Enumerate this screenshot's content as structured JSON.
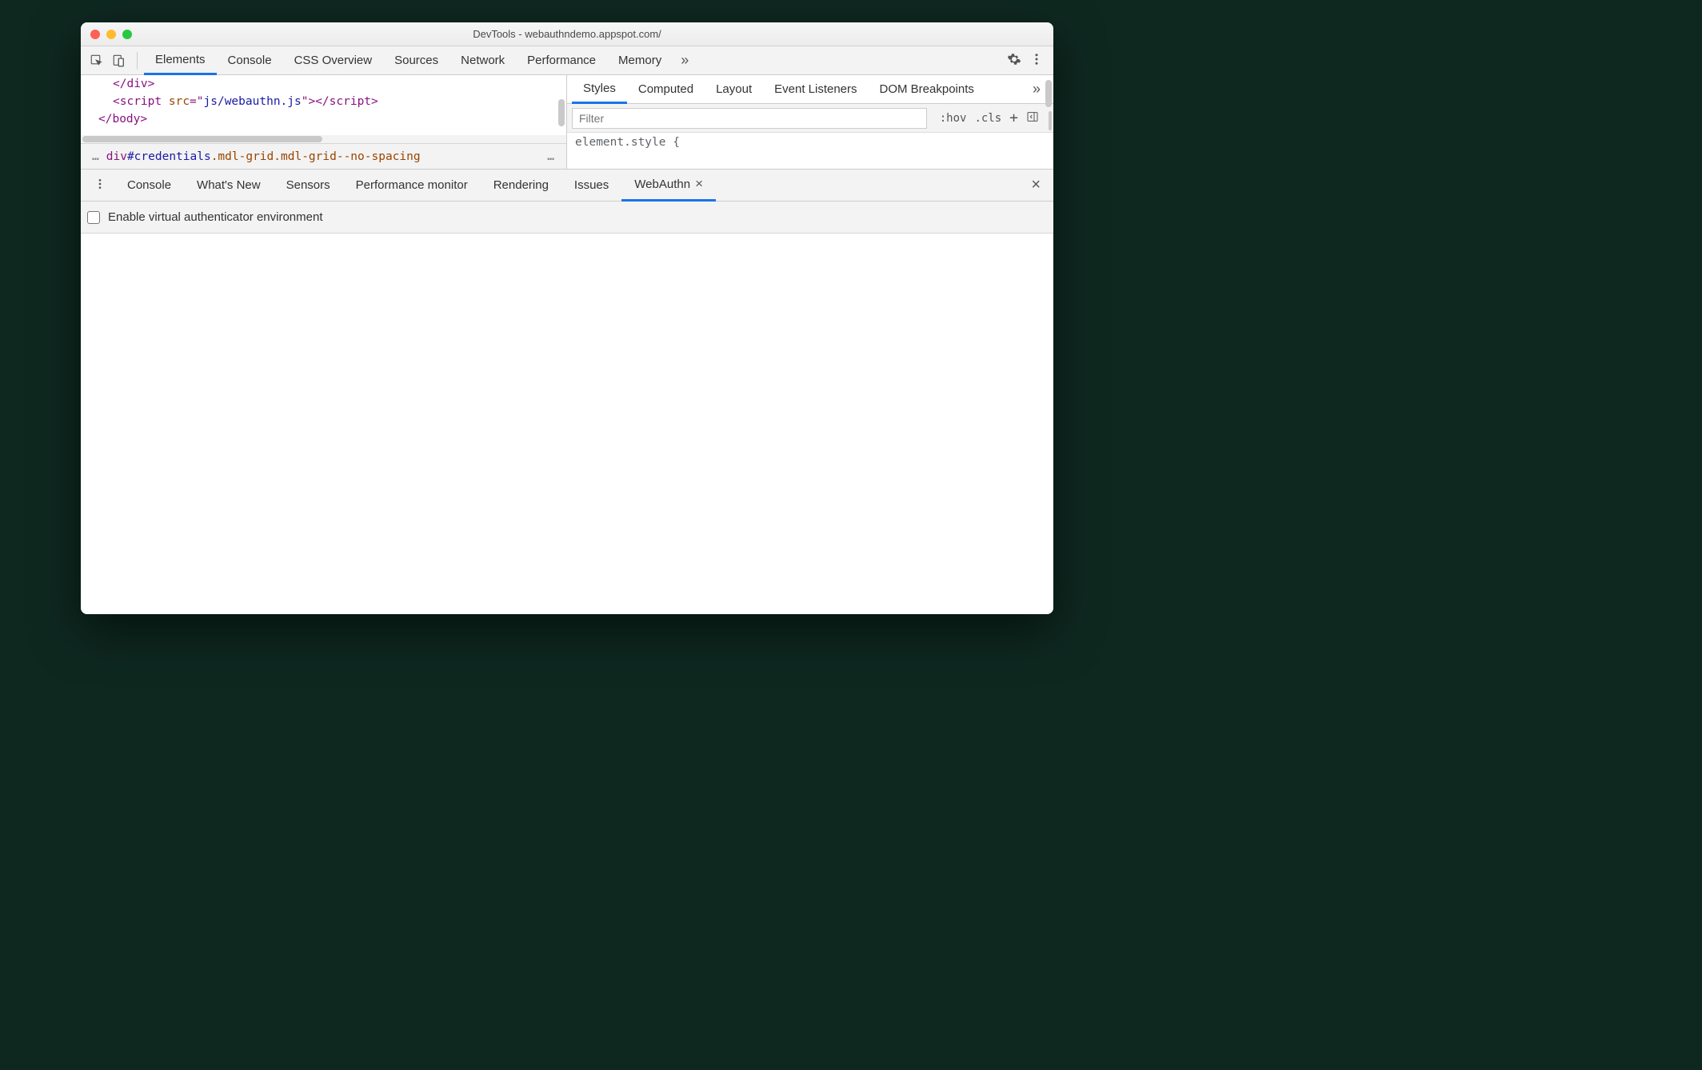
{
  "window": {
    "title": "DevTools - webauthndemo.appspot.com/"
  },
  "main_tabs": [
    "Elements",
    "Console",
    "CSS Overview",
    "Sources",
    "Network",
    "Performance",
    "Memory"
  ],
  "main_tabs_active_index": 0,
  "overflow_glyph": "»",
  "code_lines": {
    "l1_close_div": "</div>",
    "l2_open": "<",
    "l2_tag": "script",
    "l2_attr": " src",
    "l2_eq": "=\"",
    "l2_str": "js/webauthn.js",
    "l2_close": "\"></",
    "l2_tag2": "script",
    "l2_end": ">",
    "l3_close_body": "</body>"
  },
  "breadcrumb": {
    "ellipsis": "…",
    "tag": "div",
    "id": "#credentials",
    "classes": ".mdl-grid.mdl-grid--no-spacing",
    "ellipsis2": "…"
  },
  "styles_sub_tabs": [
    "Styles",
    "Computed",
    "Layout",
    "Event Listeners",
    "DOM Breakpoints"
  ],
  "styles_sub_tabs_active_index": 0,
  "filter": {
    "placeholder": "Filter",
    "hov": ":hov",
    "cls": ".cls"
  },
  "style_body": "element.style {",
  "drawer_tabs": [
    "Console",
    "What's New",
    "Sensors",
    "Performance monitor",
    "Rendering",
    "Issues",
    "WebAuthn"
  ],
  "drawer_tabs_active_index": 6,
  "webauthn": {
    "enable_label": "Enable virtual authenticator environment"
  }
}
